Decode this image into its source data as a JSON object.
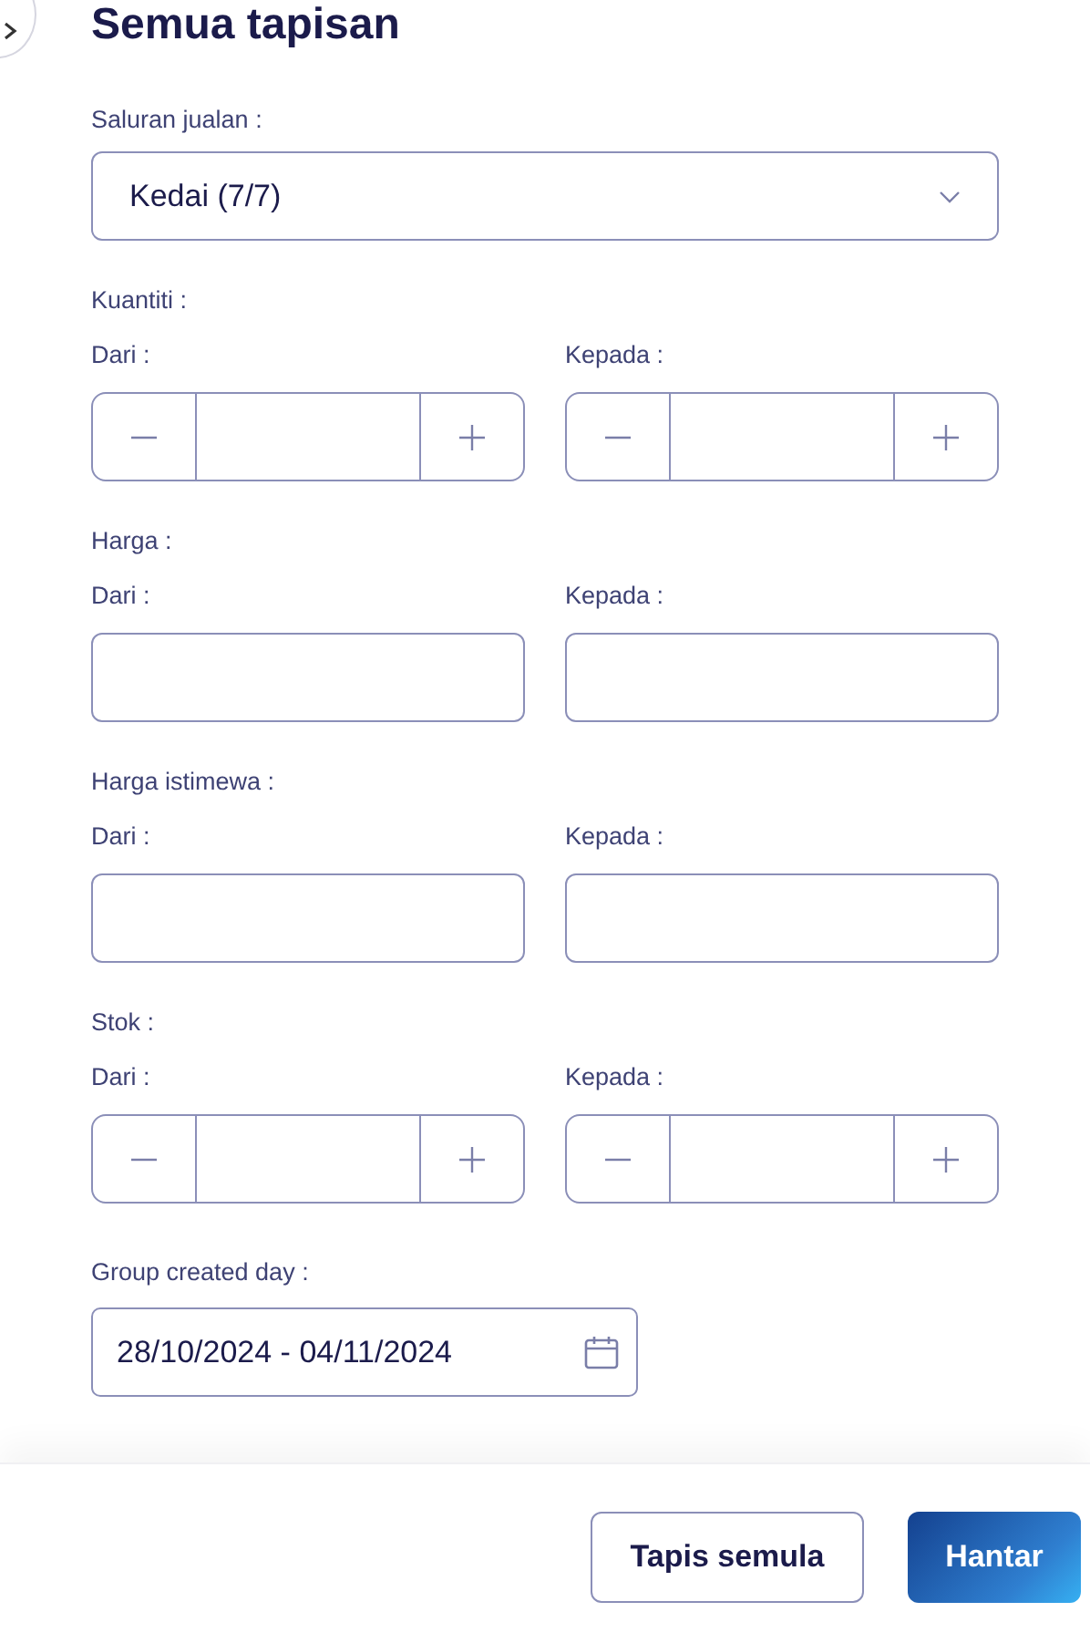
{
  "title": "Semua tapisan",
  "sales_channel": {
    "label": "Saluran jualan :",
    "value": "Kedai (7/7)"
  },
  "filters": [
    {
      "kind": "stepper",
      "label": "Kuantiti :",
      "from_label": "Dari :",
      "to_label": "Kepada :"
    },
    {
      "kind": "text",
      "label": "Harga :",
      "from_label": "Dari :",
      "to_label": "Kepada :"
    },
    {
      "kind": "text",
      "label": "Harga istimewa :",
      "from_label": "Dari :",
      "to_label": "Kepada :"
    },
    {
      "kind": "stepper",
      "label": "Stok :",
      "from_label": "Dari :",
      "to_label": "Kepada :"
    }
  ],
  "date_filter": {
    "label": "Group created day :",
    "value": "28/10/2024 - 04/11/2024"
  },
  "buttons": {
    "reset": "Tapis semula",
    "submit": "Hantar"
  }
}
